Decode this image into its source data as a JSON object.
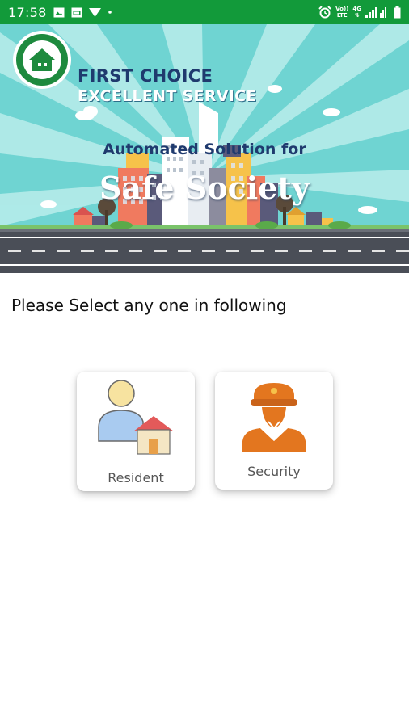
{
  "status_bar": {
    "time": "17:58",
    "network_top": "Vo))",
    "network_bottom": "LTE",
    "network_type": "4G",
    "left_icons": [
      "image-icon",
      "calendar-icon",
      "signal-download-icon",
      "dot-icon"
    ],
    "right_icons": [
      "alarm-icon",
      "signal-icon",
      "battery-icon"
    ]
  },
  "banner": {
    "brand_line1": "FIRST CHOICE",
    "brand_line2": "EXCELLENT SERVICE",
    "tagline1": "Automated Solution for",
    "tagline2": "Safe Society",
    "logo_icon": "house-logo-icon"
  },
  "content": {
    "prompt": "Please Select any one in following",
    "options": [
      {
        "label": "Resident",
        "icon": "resident-icon"
      },
      {
        "label": "Security",
        "icon": "security-guard-icon"
      }
    ]
  },
  "colors": {
    "status_bar": "#129a3a",
    "banner_sky": "#6fd4d2",
    "brand_navy": "#1f3a6e",
    "security_orange": "#e3761f"
  }
}
